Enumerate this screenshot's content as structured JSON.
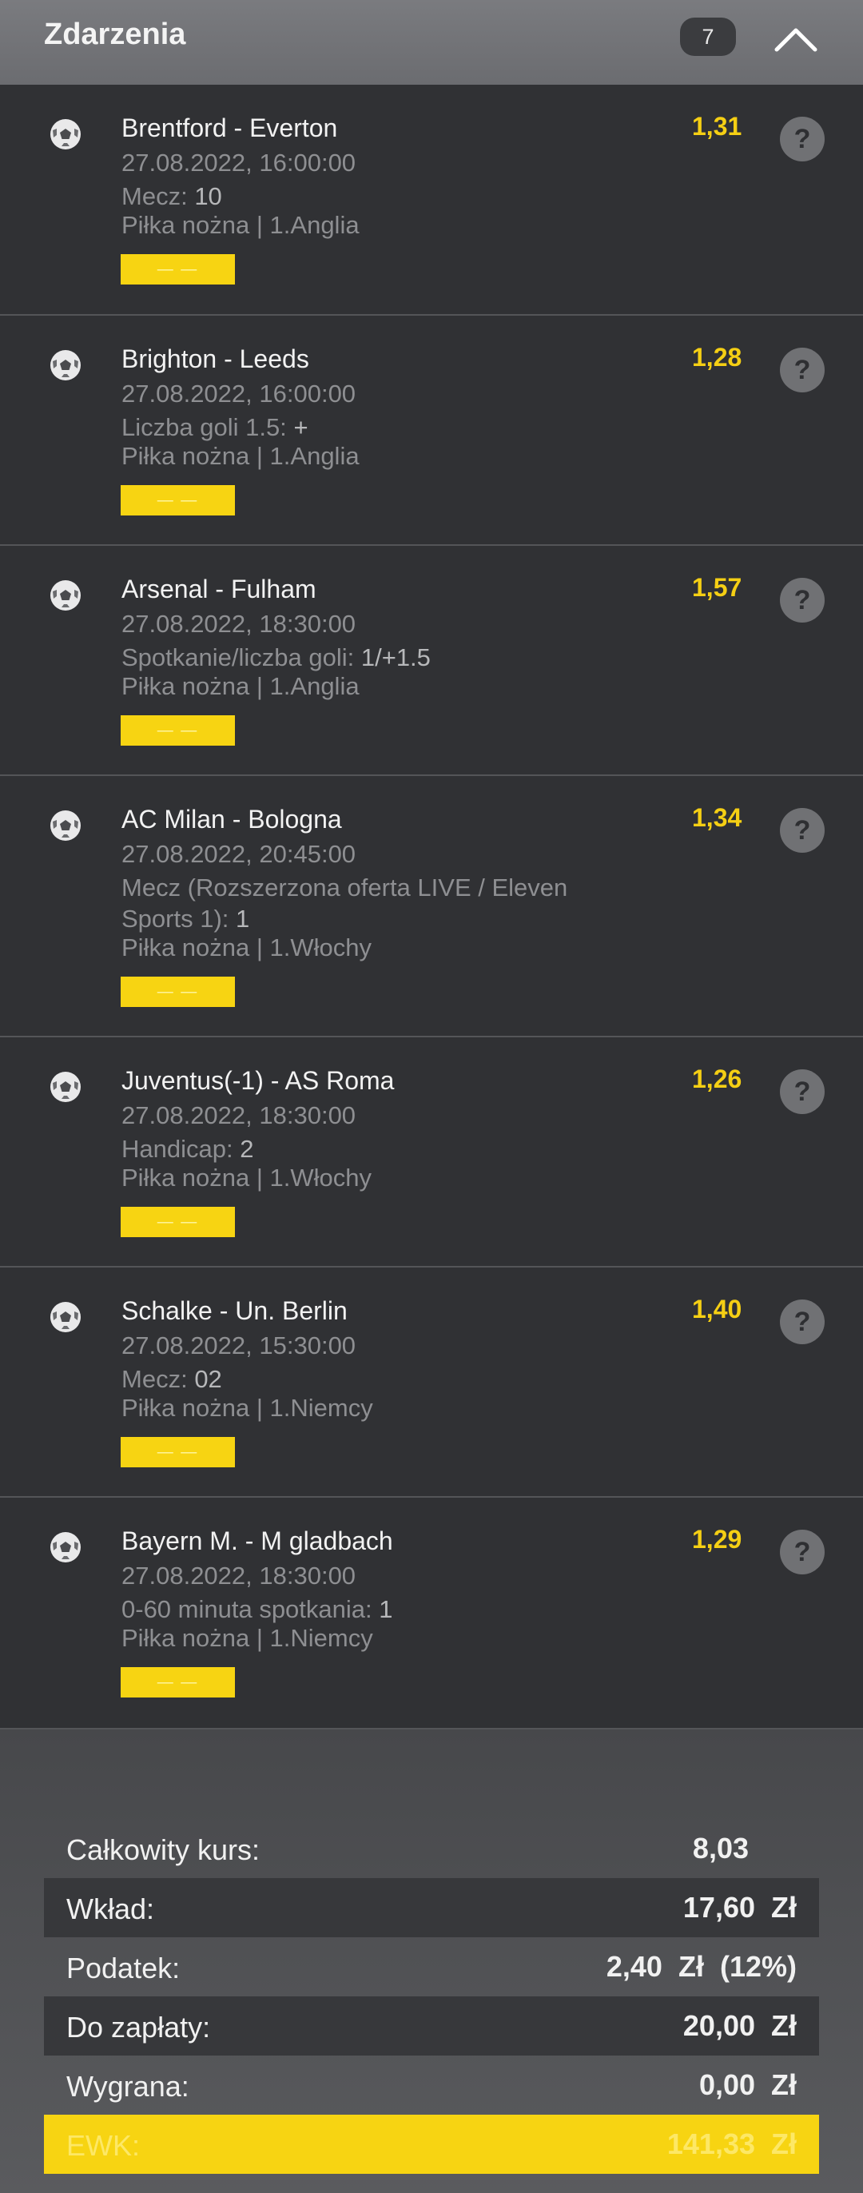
{
  "header": {
    "title": "Zdarzenia",
    "count": "7"
  },
  "events": [
    {
      "name": "Brentford - Everton",
      "date": "27.08.2022, 16:00:00",
      "bet_label": "Mecz:",
      "bet_value": "10",
      "league": "Piłka nożna | 1.Anglia",
      "odds": "1,31",
      "button": "— —"
    },
    {
      "name": "Brighton - Leeds",
      "date": "27.08.2022, 16:00:00",
      "bet_label": "Liczba goli 1.5:",
      "bet_value": "+",
      "league": "Piłka nożna | 1.Anglia",
      "odds": "1,28",
      "button": "— —"
    },
    {
      "name": "Arsenal - Fulham",
      "date": "27.08.2022, 18:30:00",
      "bet_label": "Spotkanie/liczba goli:",
      "bet_value": "1/+1.5",
      "league": "Piłka nożna | 1.Anglia",
      "odds": "1,57",
      "button": "— —"
    },
    {
      "name": "AC Milan - Bologna",
      "date": "27.08.2022, 20:45:00",
      "bet_label": "Mecz (Rozszerzona oferta LIVE / Eleven Sports 1):",
      "bet_value": "1",
      "league": "Piłka nożna | 1.Włochy",
      "odds": "1,34",
      "button": "— —"
    },
    {
      "name": "Juventus(-1) - AS Roma",
      "date": "27.08.2022, 18:30:00",
      "bet_label": "Handicap:",
      "bet_value": "2",
      "league": "Piłka nożna | 1.Włochy",
      "odds": "1,26",
      "button": "— —"
    },
    {
      "name": "Schalke - Un. Berlin",
      "date": "27.08.2022, 15:30:00",
      "bet_label": "Mecz:",
      "bet_value": "02",
      "league": "Piłka nożna | 1.Niemcy",
      "odds": "1,40",
      "button": "— —"
    },
    {
      "name": "Bayern M. - M gladbach",
      "date": "27.08.2022, 18:30:00",
      "bet_label": "0-60 minuta spotkania:",
      "bet_value": "1",
      "league": "Piłka nożna | 1.Niemcy",
      "odds": "1,29",
      "button": "— —"
    }
  ],
  "summary": {
    "total_odds_label": "Całkowity kurs:",
    "total_odds_value": "8,03",
    "stake_label": "Wkład:",
    "stake_value": "17,60  Zł",
    "tax_label": "Podatek:",
    "tax_value": "2,40  Zł  (12%)",
    "to_pay_label": "Do zapłaty:",
    "to_pay_value": "20,00  Zł",
    "win_label": "Wygrana:",
    "win_value": "0,00  Zł",
    "ewk_label": "EWK:",
    "ewk_value": "141,33  Zł"
  },
  "colors": {
    "accent": "#f7d412",
    "odds": "#f5cf14",
    "background": "#303134"
  }
}
